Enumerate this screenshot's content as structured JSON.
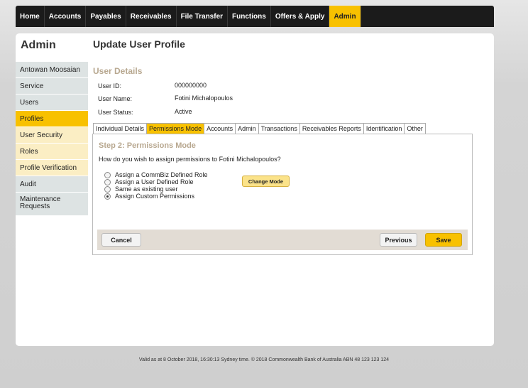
{
  "nav": {
    "items": [
      {
        "label": "Home"
      },
      {
        "label": "Accounts"
      },
      {
        "label": "Payables"
      },
      {
        "label": "Receivables"
      },
      {
        "label": "File Transfer"
      },
      {
        "label": "Functions"
      },
      {
        "label": "Offers & Apply"
      },
      {
        "label": "Admin",
        "active": true
      }
    ]
  },
  "sidebar": {
    "title": "Admin",
    "items": [
      {
        "label": "Antowan Moosaian"
      },
      {
        "label": "Service"
      },
      {
        "label": "Users"
      },
      {
        "label": "Profiles",
        "active": true
      },
      {
        "label": "User Security"
      },
      {
        "label": "Roles"
      },
      {
        "label": "Profile Verification"
      },
      {
        "label": "Audit"
      },
      {
        "label": "Maintenance Requests"
      }
    ]
  },
  "main": {
    "page_title": "Update User Profile",
    "section_title": "User Details",
    "details": [
      {
        "label": "User ID:",
        "value": "000000000"
      },
      {
        "label": "User Name:",
        "value": "Fotini Michalopoulos"
      },
      {
        "label": "User Status:",
        "value": "Active"
      }
    ],
    "tabs": [
      {
        "label": "Individual Details"
      },
      {
        "label": "Permissions Mode",
        "active": true
      },
      {
        "label": "Accounts"
      },
      {
        "label": "Admin"
      },
      {
        "label": "Transactions"
      },
      {
        "label": "Receivables Reports"
      },
      {
        "label": "Identification"
      },
      {
        "label": "Other"
      }
    ],
    "step_title": "Step 2: Permissions Mode",
    "question": "How do you wish to assign permissions to Fotini Michalopoulos?",
    "options": [
      {
        "label": "Assign a CommBiz Defined Role",
        "checked": false
      },
      {
        "label": "Assign a User Defined Role",
        "checked": false
      },
      {
        "label": "Same as existing user",
        "checked": false
      },
      {
        "label": "Assign Custom Permissions",
        "checked": true
      }
    ],
    "change_mode_label": "Change Mode",
    "cancel_label": "Cancel",
    "previous_label": "Previous",
    "save_label": "Save"
  },
  "footer": {
    "text": "Valid as at 8 October 2018, 16:30:13 Sydney time. © 2018 Commonwealth Bank of Australia ABN 48 123 123 124"
  },
  "colors": {
    "accent": "#f8c100",
    "nav_bg": "#1b1b1b",
    "section_title": "#b8a890"
  }
}
